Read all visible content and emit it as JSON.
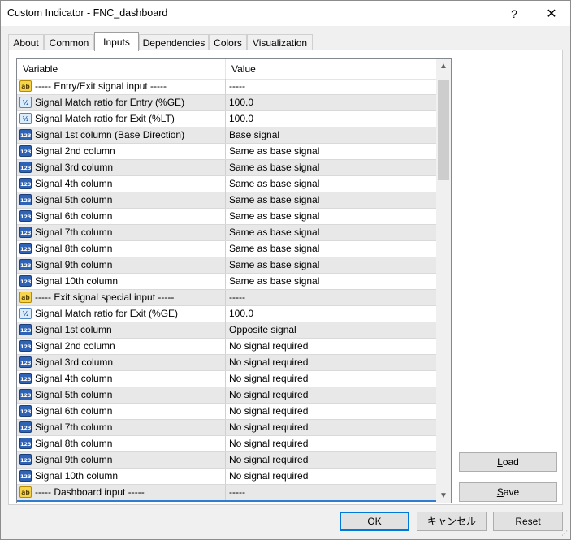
{
  "window": {
    "title": "Custom Indicator - FNC_dashboard",
    "help_glyph": "?",
    "close_glyph": "✕"
  },
  "tabs": [
    {
      "label": "About",
      "active": false
    },
    {
      "label": "Common",
      "active": false
    },
    {
      "label": "Inputs",
      "active": true
    },
    {
      "label": "Dependencies",
      "active": false
    },
    {
      "label": "Colors",
      "active": false
    },
    {
      "label": "Visualization",
      "active": false
    }
  ],
  "grid": {
    "columns": {
      "variable": "Variable",
      "value": "Value"
    },
    "rows": [
      {
        "icon": "string-icon",
        "icon_text": "ab",
        "variable": "----- Entry/Exit signal input -----",
        "value": "-----"
      },
      {
        "icon": "double-icon",
        "icon_text": "½",
        "variable": "Signal Match ratio for Entry (%GE)",
        "value": "100.0"
      },
      {
        "icon": "double-icon",
        "icon_text": "½",
        "variable": "Signal Match ratio for Exit (%LT)",
        "value": "100.0"
      },
      {
        "icon": "enum-icon",
        "icon_text": "123",
        "variable": "Signal 1st column (Base Direction)",
        "value": "Base signal"
      },
      {
        "icon": "enum-icon",
        "icon_text": "123",
        "variable": "Signal 2nd column",
        "value": "Same as base signal"
      },
      {
        "icon": "enum-icon",
        "icon_text": "123",
        "variable": "Signal 3rd column",
        "value": "Same as base signal"
      },
      {
        "icon": "enum-icon",
        "icon_text": "123",
        "variable": "Signal 4th column",
        "value": "Same as base signal"
      },
      {
        "icon": "enum-icon",
        "icon_text": "123",
        "variable": "Signal 5th column",
        "value": "Same as base signal"
      },
      {
        "icon": "enum-icon",
        "icon_text": "123",
        "variable": "Signal 6th column",
        "value": "Same as base signal"
      },
      {
        "icon": "enum-icon",
        "icon_text": "123",
        "variable": "Signal 7th column",
        "value": "Same as base signal"
      },
      {
        "icon": "enum-icon",
        "icon_text": "123",
        "variable": "Signal 8th column",
        "value": "Same as base signal"
      },
      {
        "icon": "enum-icon",
        "icon_text": "123",
        "variable": "Signal 9th column",
        "value": "Same as base signal"
      },
      {
        "icon": "enum-icon",
        "icon_text": "123",
        "variable": "Signal 10th column",
        "value": "Same as base signal"
      },
      {
        "icon": "string-icon",
        "icon_text": "ab",
        "variable": "----- Exit signal special input -----",
        "value": "-----"
      },
      {
        "icon": "double-icon",
        "icon_text": "½",
        "variable": "Signal Match ratio for Exit (%GE)",
        "value": "100.0"
      },
      {
        "icon": "enum-icon",
        "icon_text": "123",
        "variable": "Signal 1st column",
        "value": "Opposite signal"
      },
      {
        "icon": "enum-icon",
        "icon_text": "123",
        "variable": "Signal 2nd column",
        "value": "No signal required"
      },
      {
        "icon": "enum-icon",
        "icon_text": "123",
        "variable": "Signal 3rd column",
        "value": "No signal required"
      },
      {
        "icon": "enum-icon",
        "icon_text": "123",
        "variable": "Signal 4th column",
        "value": "No signal required"
      },
      {
        "icon": "enum-icon",
        "icon_text": "123",
        "variable": "Signal 5th column",
        "value": "No signal required"
      },
      {
        "icon": "enum-icon",
        "icon_text": "123",
        "variable": "Signal 6th column",
        "value": "No signal required"
      },
      {
        "icon": "enum-icon",
        "icon_text": "123",
        "variable": "Signal 7th column",
        "value": "No signal required"
      },
      {
        "icon": "enum-icon",
        "icon_text": "123",
        "variable": "Signal 8th column",
        "value": "No signal required"
      },
      {
        "icon": "enum-icon",
        "icon_text": "123",
        "variable": "Signal 9th column",
        "value": "No signal required"
      },
      {
        "icon": "enum-icon",
        "icon_text": "123",
        "variable": "Signal 10th column",
        "value": "No signal required"
      },
      {
        "icon": "string-icon",
        "icon_text": "ab",
        "variable": "----- Dashboard input -----",
        "value": "-----"
      }
    ]
  },
  "side_buttons": {
    "load": "Load",
    "load_accel": "L",
    "save": "Save",
    "save_accel": "S"
  },
  "footer": {
    "ok": "OK",
    "cancel": "キャンセル",
    "reset": "Reset"
  },
  "colors": {
    "accent": "#0078d7",
    "alt_row": "#e8e8e8",
    "selection": "#2f7dd1"
  }
}
